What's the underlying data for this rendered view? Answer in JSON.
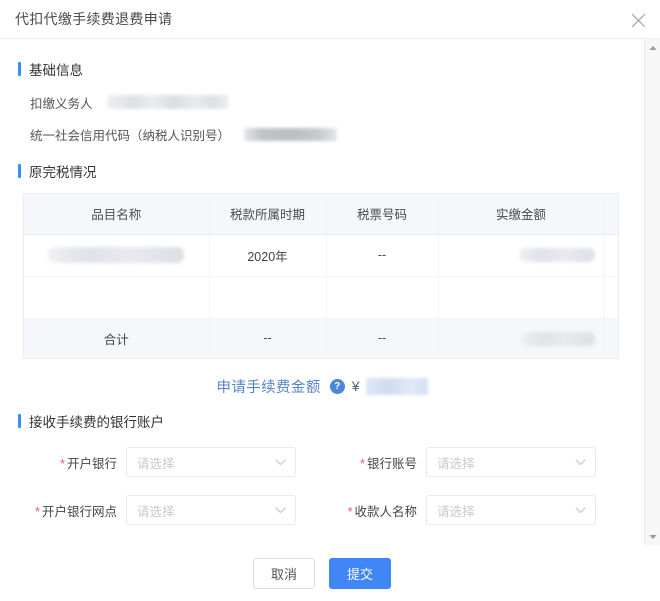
{
  "dialog": {
    "title": "代扣代缴手续费退费申请",
    "close_icon": "close-icon"
  },
  "sections": {
    "basic_info": {
      "title": "基础信息",
      "fields": [
        {
          "label": "扣缴义务人",
          "value": "",
          "redacted": true
        },
        {
          "label": "统一社会信用代码（纳税人识别号）",
          "value": "",
          "redacted": true
        }
      ]
    },
    "original_tax": {
      "title": "原完税情况"
    },
    "bank_account": {
      "title": "接收手续费的银行账户"
    }
  },
  "table": {
    "headers": [
      "品目名称",
      "税款所属时期",
      "税票号码",
      "实缴金额"
    ],
    "rows": [
      {
        "item_name": "",
        "tax_period": "2020年",
        "tax_bill_no": "--",
        "paid_amount": ""
      }
    ],
    "total_row": {
      "label": "合计",
      "tax_period": "--",
      "tax_bill_no": "--",
      "paid_amount": ""
    }
  },
  "fee_amount": {
    "label": "申请手续费金额",
    "help_icon": "question-mark-icon",
    "currency": "¥",
    "value": ""
  },
  "form": {
    "placeholder": "请选择",
    "required_mark": "*",
    "fields": [
      {
        "label": "开户银行",
        "value": "",
        "placeholder": "请选择",
        "required": true
      },
      {
        "label": "银行账号",
        "value": "",
        "placeholder": "请选择",
        "required": true
      },
      {
        "label": "开户银行网点",
        "value": "",
        "placeholder": "请选择",
        "required": true
      },
      {
        "label": "收款人名称",
        "value": "",
        "placeholder": "请选择",
        "required": true
      }
    ]
  },
  "footer": {
    "cancel_label": "取消",
    "submit_label": "提交"
  },
  "colors": {
    "accent": "#3f8cff",
    "primary_button": "#4086f4",
    "required": "#f15a5a",
    "link_text": "#5585c9",
    "table_header_bg": "#f5f7fa"
  }
}
